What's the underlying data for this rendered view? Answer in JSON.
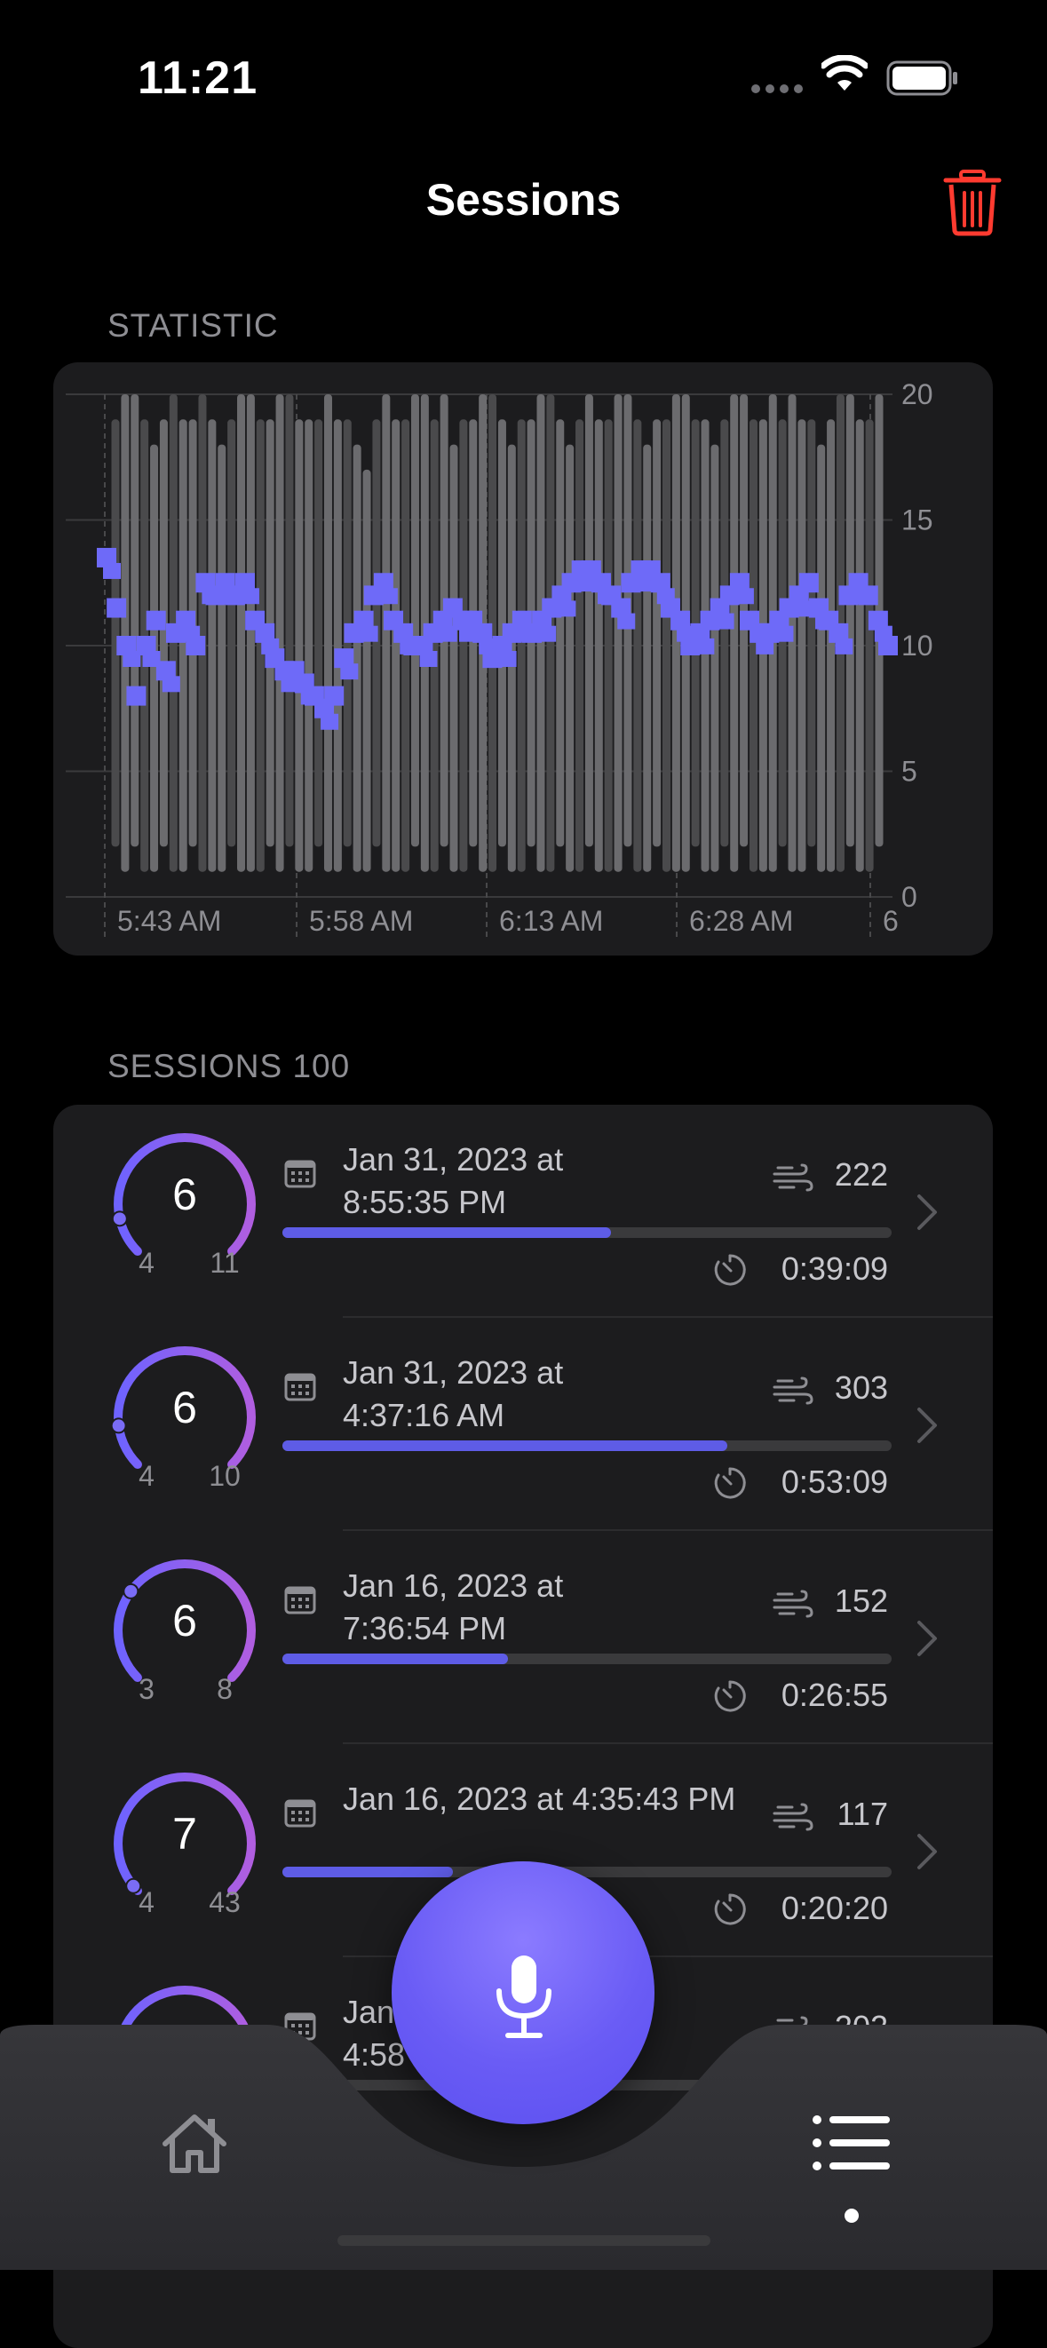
{
  "status_bar": {
    "time": "11:21"
  },
  "nav": {
    "title": "Sessions"
  },
  "statistic": {
    "section_label": "STATISTIC"
  },
  "chart_data": {
    "type": "bar",
    "description_series": [
      {
        "name": "range",
        "kind": "range-bars"
      },
      {
        "name": "mean",
        "kind": "scatter-squares",
        "color": "#6e6af8"
      }
    ],
    "ylim": [
      0,
      20
    ],
    "y_ticks": [
      "20",
      "15",
      "10",
      "5",
      "0"
    ],
    "x_ticks": [
      "5:43 AM",
      "5:58 AM",
      "6:13 AM",
      "6:28 AM",
      "6"
    ],
    "range_low": [
      2,
      1,
      2,
      1,
      1,
      2,
      1,
      1,
      2,
      1,
      1,
      1,
      2,
      1,
      1,
      1,
      2,
      1,
      2,
      1,
      1,
      2,
      1,
      1,
      2,
      1,
      1,
      2,
      1,
      1,
      1,
      2,
      1,
      1,
      2,
      1,
      1,
      2,
      1,
      1,
      2,
      1,
      1,
      2,
      1,
      1,
      2,
      1,
      1,
      2,
      1,
      1,
      1,
      2,
      1,
      1,
      2,
      1,
      1,
      1,
      2,
      1,
      1,
      2,
      1,
      2,
      1,
      1,
      1,
      2,
      1,
      1,
      2,
      1,
      1,
      1,
      2,
      1,
      1,
      2
    ],
    "range_high": [
      19,
      20,
      20,
      19,
      18,
      19,
      20,
      19,
      19,
      20,
      19,
      18,
      19,
      20,
      20,
      19,
      19,
      20,
      20,
      19,
      19,
      19,
      20,
      19,
      19,
      18,
      17,
      19,
      20,
      19,
      19,
      20,
      20,
      19,
      20,
      18,
      19,
      19,
      20,
      20,
      19,
      18,
      19,
      19,
      20,
      20,
      19,
      18,
      19,
      20,
      19,
      19,
      20,
      20,
      19,
      18,
      19,
      19,
      20,
      20,
      19,
      19,
      18,
      19,
      20,
      20,
      19,
      19,
      20,
      19,
      20,
      19,
      19,
      18,
      19,
      20,
      20,
      19,
      19,
      20
    ],
    "mean_values": [
      13.5,
      11.5,
      10,
      8,
      10,
      11,
      9,
      10.5,
      11,
      10,
      12.5,
      12,
      12.5,
      12,
      12.5,
      11,
      10.5,
      9.5,
      9,
      9,
      8.5,
      8,
      7.5,
      8,
      9.5,
      10.5,
      11,
      12,
      12.5,
      11,
      10.5,
      10,
      10,
      10.5,
      11,
      11.5,
      11,
      11,
      10.5,
      9.5,
      10,
      10.5,
      11,
      10.5,
      11,
      11.5,
      12,
      12.5,
      13,
      13,
      12.5,
      12,
      11.5,
      12.5,
      13,
      13,
      12.5,
      11.5,
      11,
      10,
      10.5,
      11,
      11.5,
      12,
      12.5,
      11,
      10.5,
      10.5,
      11,
      11.5,
      12,
      12.5,
      11.5,
      11,
      10.5,
      12,
      12.5,
      12,
      11,
      10
    ]
  },
  "sessions": {
    "section_label": "SESSIONS 100",
    "items": [
      {
        "mean": "6",
        "min": "4",
        "max": "11",
        "date": "Jan 31, 2023 at\n8:55:35 PM",
        "breaths": "222",
        "duration": "0:39:09",
        "progress": 0.54,
        "marker": 0.12
      },
      {
        "mean": "6",
        "min": "4",
        "max": "10",
        "date": "Jan 31, 2023 at\n4:37:16 AM",
        "breaths": "303",
        "duration": "0:53:09",
        "progress": 0.73,
        "marker": 0.14
      },
      {
        "mean": "6",
        "min": "3",
        "max": "8",
        "date": "Jan 16, 2023 at\n7:36:54 PM",
        "breaths": "152",
        "duration": "0:26:55",
        "progress": 0.37,
        "marker": 0.3
      },
      {
        "mean": "7",
        "min": "4",
        "max": "43",
        "date": "Jan 16, 2023 at 4:35:43 PM",
        "breaths": "117",
        "duration": "0:20:20",
        "progress": 0.28,
        "marker": 0.02
      },
      {
        "mean": "",
        "min": "",
        "max": "",
        "date": "Jan\n4:58",
        "breaths": "202",
        "duration": "",
        "progress": 0.1,
        "marker": 0.12
      }
    ]
  },
  "colors": {
    "accent": "#5e5ce6",
    "gauge_start": "#6e63ff",
    "gauge_end": "#b05ee0",
    "trash": "#ff3b30",
    "card": "#1c1c1e"
  },
  "tabbar": {
    "items": [
      {
        "icon": "house-icon"
      },
      {
        "icon": "list-icon",
        "selected": true
      }
    ],
    "center": {
      "icon": "microphone-icon"
    }
  }
}
